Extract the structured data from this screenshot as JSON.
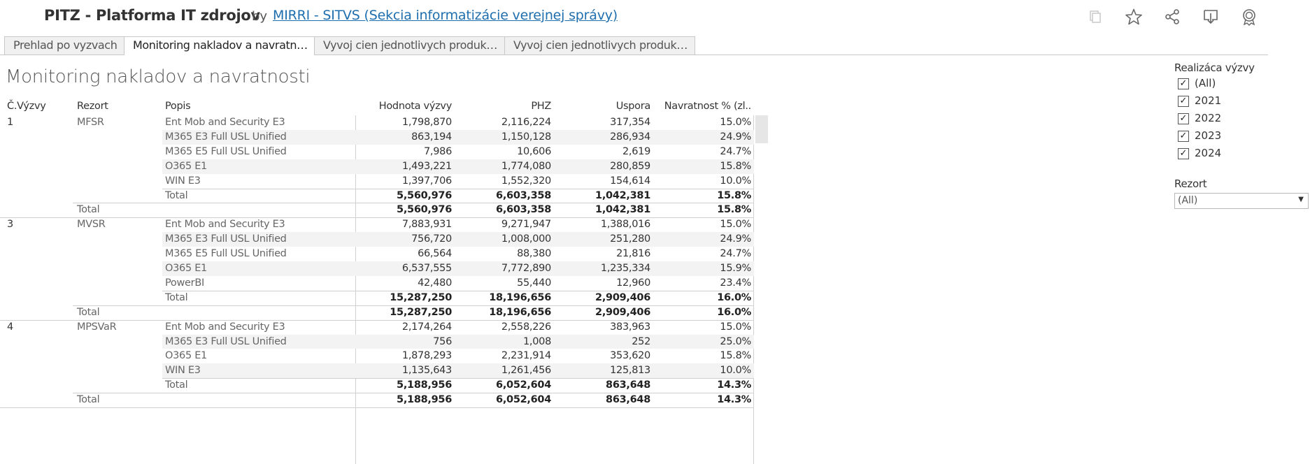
{
  "header": {
    "title": "PITZ - Platforma IT zdrojov",
    "by": "by",
    "author": "MIRRI - SITVS (Sekcia informatizácie verejnej správy)",
    "icons": [
      "copy-icon",
      "star-icon",
      "share-icon",
      "download-icon",
      "badge-icon"
    ]
  },
  "tabs": [
    {
      "label": "Prehlad po vyzvach"
    },
    {
      "label": "Monitoring nakladov a navratnosti"
    },
    {
      "label": "Vyvoj cien jednotlivych produktov"
    },
    {
      "label": "Vyvoj cien jednotlivych produktov"
    }
  ],
  "sheet": {
    "title": "Monitoring nakladov a navratnosti",
    "columns": {
      "vyzva": "Č.Výzvy",
      "rezort": "Rezort",
      "popis": "Popis",
      "hodnota": "Hodnota výzvy",
      "phz": "PHZ",
      "uspora": "Uspora",
      "navratnost": "Navratnost % (zl.."
    }
  },
  "table_rows": [
    {
      "vyzva": "1",
      "rezort": "MFSR",
      "popis": "Ent Mob and Security E3",
      "hodnota": "1,798,870",
      "phz": "2,116,224",
      "uspora": "317,354",
      "navratnost": "15.0%",
      "kind": "item"
    },
    {
      "vyzva": "",
      "rezort": "",
      "popis": "M365 E3 Full USL Unified",
      "hodnota": "863,194",
      "phz": "1,150,128",
      "uspora": "286,934",
      "navratnost": "24.9%",
      "kind": "item"
    },
    {
      "vyzva": "",
      "rezort": "",
      "popis": "M365 E5 Full USL Unified",
      "hodnota": "7,986",
      "phz": "10,606",
      "uspora": "2,619",
      "navratnost": "24.7%",
      "kind": "item"
    },
    {
      "vyzva": "",
      "rezort": "",
      "popis": "O365 E1",
      "hodnota": "1,493,221",
      "phz": "1,774,080",
      "uspora": "280,859",
      "navratnost": "15.8%",
      "kind": "item"
    },
    {
      "vyzva": "",
      "rezort": "",
      "popis": "WIN E3",
      "hodnota": "1,397,706",
      "phz": "1,552,320",
      "uspora": "154,614",
      "navratnost": "10.0%",
      "kind": "item"
    },
    {
      "vyzva": "",
      "rezort": "",
      "popis": "Total",
      "hodnota": "5,560,976",
      "phz": "6,603,358",
      "uspora": "1,042,381",
      "navratnost": "15.8%",
      "kind": "subtotal"
    },
    {
      "vyzva": "",
      "rezort": "Total",
      "popis": "",
      "hodnota": "5,560,976",
      "phz": "6,603,358",
      "uspora": "1,042,381",
      "navratnost": "15.8%",
      "kind": "total"
    },
    {
      "vyzva": "3",
      "rezort": "MVSR",
      "popis": "Ent Mob and Security E3",
      "hodnota": "7,883,931",
      "phz": "9,271,947",
      "uspora": "1,388,016",
      "navratnost": "15.0%",
      "kind": "item"
    },
    {
      "vyzva": "",
      "rezort": "",
      "popis": "M365 E3 Full USL Unified",
      "hodnota": "756,720",
      "phz": "1,008,000",
      "uspora": "251,280",
      "navratnost": "24.9%",
      "kind": "item"
    },
    {
      "vyzva": "",
      "rezort": "",
      "popis": "M365 E5 Full USL Unified",
      "hodnota": "66,564",
      "phz": "88,380",
      "uspora": "21,816",
      "navratnost": "24.7%",
      "kind": "item"
    },
    {
      "vyzva": "",
      "rezort": "",
      "popis": "O365 E1",
      "hodnota": "6,537,555",
      "phz": "7,772,890",
      "uspora": "1,235,334",
      "navratnost": "15.9%",
      "kind": "item"
    },
    {
      "vyzva": "",
      "rezort": "",
      "popis": "PowerBI",
      "hodnota": "42,480",
      "phz": "55,440",
      "uspora": "12,960",
      "navratnost": "23.4%",
      "kind": "item"
    },
    {
      "vyzva": "",
      "rezort": "",
      "popis": "Total",
      "hodnota": "15,287,250",
      "phz": "18,196,656",
      "uspora": "2,909,406",
      "navratnost": "16.0%",
      "kind": "subtotal"
    },
    {
      "vyzva": "",
      "rezort": "Total",
      "popis": "",
      "hodnota": "15,287,250",
      "phz": "18,196,656",
      "uspora": "2,909,406",
      "navratnost": "16.0%",
      "kind": "total"
    },
    {
      "vyzva": "4",
      "rezort": "MPSVaR",
      "popis": "Ent Mob and Security E3",
      "hodnota": "2,174,264",
      "phz": "2,558,226",
      "uspora": "383,963",
      "navratnost": "15.0%",
      "kind": "item"
    },
    {
      "vyzva": "",
      "rezort": "",
      "popis": "M365 E3 Full USL Unified",
      "hodnota": "756",
      "phz": "1,008",
      "uspora": "252",
      "navratnost": "25.0%",
      "kind": "item"
    },
    {
      "vyzva": "",
      "rezort": "",
      "popis": "O365 E1",
      "hodnota": "1,878,293",
      "phz": "2,231,914",
      "uspora": "353,620",
      "navratnost": "15.8%",
      "kind": "item"
    },
    {
      "vyzva": "",
      "rezort": "",
      "popis": "WIN E3",
      "hodnota": "1,135,643",
      "phz": "1,261,456",
      "uspora": "125,813",
      "navratnost": "10.0%",
      "kind": "item"
    },
    {
      "vyzva": "",
      "rezort": "",
      "popis": "Total",
      "hodnota": "5,188,956",
      "phz": "6,052,604",
      "uspora": "863,648",
      "navratnost": "14.3%",
      "kind": "subtotal"
    },
    {
      "vyzva": "",
      "rezort": "Total",
      "popis": "",
      "hodnota": "5,188,956",
      "phz": "6,052,604",
      "uspora": "863,648",
      "navratnost": "14.3%",
      "kind": "total"
    }
  ],
  "filters": {
    "realizacia": {
      "title": "Realizáca výzvy",
      "options": [
        {
          "label": "(All)",
          "checked": true
        },
        {
          "label": "2021",
          "checked": true
        },
        {
          "label": "2022",
          "checked": true
        },
        {
          "label": "2023",
          "checked": true
        },
        {
          "label": "2024",
          "checked": true
        }
      ]
    },
    "rezort": {
      "title": "Rezort",
      "selected": "(All)"
    }
  },
  "colors": {
    "link": "#1f6fae",
    "band": "#f3f3f3",
    "grid": "#d0d0d0"
  }
}
